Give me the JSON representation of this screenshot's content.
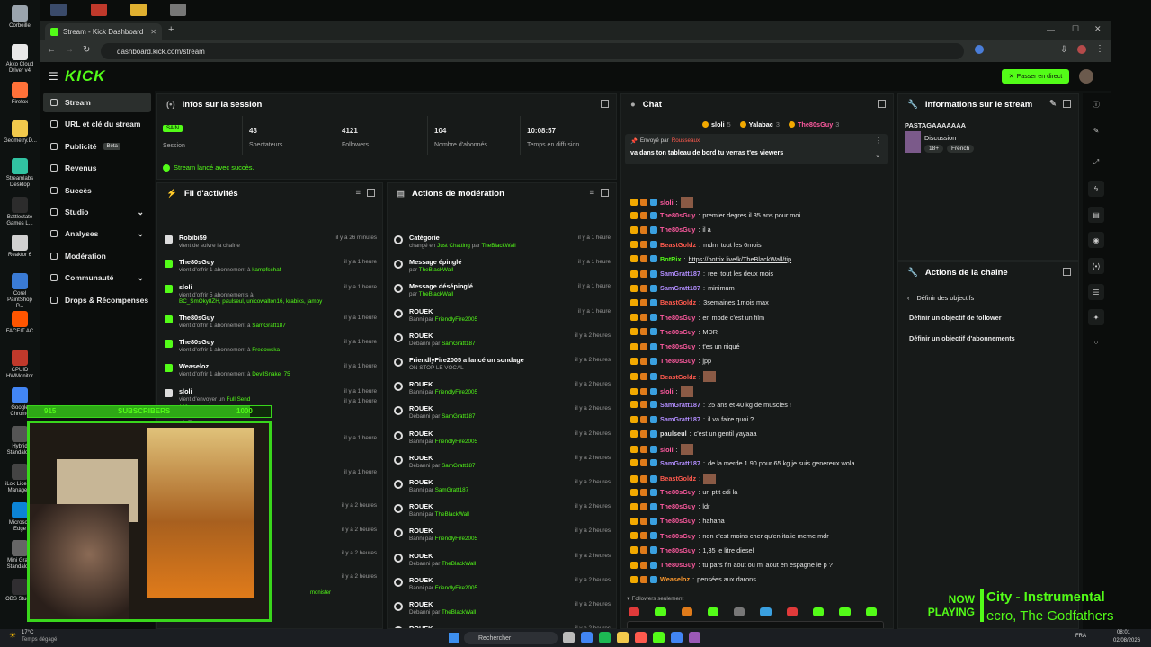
{
  "desktop": {
    "icons": [
      {
        "label": "Corbeille",
        "color": "#9aa4ad"
      },
      {
        "label": "Akko Cloud Driver v4",
        "color": "#e8e8e8"
      },
      {
        "label": "Firefox",
        "color": "#ff7139"
      },
      {
        "label": "Geometry.D...",
        "color": "#f2c94c"
      },
      {
        "label": "Streamlabs Desktop",
        "color": "#31c3a2"
      },
      {
        "label": "Battlestate Games L...",
        "color": "#2c2c2c"
      },
      {
        "label": "Reaktor 6",
        "color": "#d0d0d0"
      },
      {
        "label": "Corel PaintShop P...",
        "color": "#3a7bd5"
      },
      {
        "label": "FACEIT AC",
        "color": "#ff5500"
      },
      {
        "label": "CPUID HWMonitor",
        "color": "#c0392b"
      },
      {
        "label": "Google Chrome",
        "color": "#4285f4"
      },
      {
        "label": "Hybrid Standalo...",
        "color": "#555"
      },
      {
        "label": "iLok Licen... Manage...",
        "color": "#444"
      },
      {
        "label": "Microsoft Edge",
        "color": "#0c84d6"
      },
      {
        "label": "Mini Gra... Standalo...",
        "color": "#666"
      },
      {
        "label": "OBS Stud...",
        "color": "#302e31"
      }
    ]
  },
  "browser": {
    "tab_title": "Stream - Kick Dashboard",
    "url": "dashboard.kick.com/stream"
  },
  "kick": {
    "logo": "KICK",
    "go_live": "Passer en direct"
  },
  "sidebar": {
    "items": [
      {
        "label": "Stream",
        "icon": "signal-icon"
      },
      {
        "label": "URL et clé du stream",
        "icon": "link-icon"
      },
      {
        "label": "Publicité",
        "icon": "megaphone-icon",
        "badge": "Beta"
      },
      {
        "label": "Revenus",
        "icon": "dollar-icon"
      },
      {
        "label": "Succès",
        "icon": "trophy-icon"
      },
      {
        "label": "Studio",
        "icon": "tools-icon",
        "chevron": true
      },
      {
        "label": "Analyses",
        "icon": "chart-icon",
        "chevron": true
      },
      {
        "label": "Modération",
        "icon": "shield-icon"
      },
      {
        "label": "Communauté",
        "icon": "users-icon",
        "chevron": true
      },
      {
        "label": "Drops & Récompenses",
        "icon": "gift-icon"
      }
    ]
  },
  "session": {
    "title": "Infos sur la session",
    "status_badge": "SAIN",
    "status_label": "Session",
    "stats": [
      {
        "value": "43",
        "label": "Spectateurs"
      },
      {
        "value": "4121",
        "label": "Followers"
      },
      {
        "value": "104",
        "label": "Nombre d'abonnés"
      },
      {
        "value": "10:08:57",
        "label": "Temps en diffusion"
      }
    ],
    "success": "Stream lancé avec succès."
  },
  "activity": {
    "title": "Fil d'activités",
    "items": [
      {
        "name": "Robibi59",
        "sub": "vient de suivre la chaîne",
        "tag": "",
        "time": "il y a 26 minutes",
        "color": "#dddddd"
      },
      {
        "name": "The80sGuy",
        "sub": "vient d'offrir 1 abonnement à",
        "tag": "kampfschaf",
        "time": "il y a 1 heure",
        "color": "#53fc18"
      },
      {
        "name": "sloli",
        "sub": "vient d'offrir 5 abonnements à:",
        "tag": "BC_SmOky8ZH, paulseul, unicowalton16, krabiks, jamby",
        "time": "il y a 1 heure",
        "color": "#53fc18"
      },
      {
        "name": "The80sGuy",
        "sub": "vient d'offrir 1 abonnement à",
        "tag": "SamGratt187",
        "time": "il y a 1 heure",
        "color": "#53fc18"
      },
      {
        "name": "The80sGuy",
        "sub": "vient d'offrir 1 abonnement à",
        "tag": "Fredowska",
        "time": "il y a 1 heure",
        "color": "#53fc18"
      },
      {
        "name": "Weaseloz",
        "sub": "vient d'offrir 1 abonnement à",
        "tag": "DevilSnake_75",
        "time": "il y a 1 heure",
        "color": "#53fc18"
      },
      {
        "name": "sloli",
        "sub": "vient d'envoyer un",
        "tag": "Full Send",
        "time": "il y a 1 heure",
        "color": "#dddddd",
        "amount": "100"
      }
    ],
    "extra_times": [
      "il y a 1 heure",
      "il y a 1 heure",
      "il y a 1 heure",
      "il y a 2 heures",
      "il y a 2 heures",
      "il y a 2 heures",
      "il y a 2 heures"
    ],
    "partial_name": "sloli",
    "partial_tag": "monister"
  },
  "moderation": {
    "title": "Actions de modération",
    "items": [
      {
        "title": "Catégorie",
        "sub": "changé en",
        "a": "Just Chatting",
        "mid": "par",
        "b": "TheBlackWall",
        "time": "il y a 1 heure"
      },
      {
        "title": "Message épinglé",
        "sub": "par",
        "a": "TheBlackWall",
        "mid": "",
        "b": "",
        "time": "il y a 1 heure"
      },
      {
        "title": "Message désépinglé",
        "sub": "par",
        "a": "TheBlackWall",
        "mid": "",
        "b": "",
        "time": "il y a 1 heure"
      },
      {
        "title": "ROUEK",
        "sub": "Banni par",
        "a": "FriendlyFire2005",
        "mid": "",
        "b": "",
        "time": "il y a 1 heure"
      },
      {
        "title": "ROUEK",
        "sub": "Débanni par",
        "a": "SamGratt187",
        "mid": "",
        "b": "",
        "time": "il y a 2 heures"
      },
      {
        "title": "FriendlyFire2005 a lancé un sondage",
        "sub": "ON STOP LE VOCAL",
        "a": "",
        "mid": "",
        "b": "",
        "time": "il y a 2 heures"
      },
      {
        "title": "ROUEK",
        "sub": "Banni par",
        "a": "FriendlyFire2005",
        "mid": "",
        "b": "",
        "time": "il y a 2 heures"
      },
      {
        "title": "ROUEK",
        "sub": "Débanni par",
        "a": "SamGratt187",
        "mid": "",
        "b": "",
        "time": "il y a 2 heures"
      },
      {
        "title": "ROUEK",
        "sub": "Banni par",
        "a": "FriendlyFire2005",
        "mid": "",
        "b": "",
        "time": "il y a 2 heures"
      },
      {
        "title": "ROUEK",
        "sub": "Débanni par",
        "a": "SamGratt187",
        "mid": "",
        "b": "",
        "time": "il y a 2 heures"
      },
      {
        "title": "ROUEK",
        "sub": "Banni par",
        "a": "SamGratt187",
        "mid": "",
        "b": "",
        "time": "il y a 2 heures"
      },
      {
        "title": "ROUEK",
        "sub": "Banni par",
        "a": "TheBlackWall",
        "mid": "",
        "b": "",
        "time": "il y a 2 heures"
      },
      {
        "title": "ROUEK",
        "sub": "Banni par",
        "a": "FriendlyFire2005",
        "mid": "",
        "b": "",
        "time": "il y a 2 heures"
      },
      {
        "title": "ROUEK",
        "sub": "Débanni par",
        "a": "TheBlackWall",
        "mid": "",
        "b": "",
        "time": "il y a 2 heures"
      },
      {
        "title": "ROUEK",
        "sub": "Banni par",
        "a": "FriendlyFire2005",
        "mid": "",
        "b": "",
        "time": "il y a 2 heures"
      },
      {
        "title": "ROUEK",
        "sub": "Débanni par",
        "a": "TheBlackWall",
        "mid": "",
        "b": "",
        "time": "il y a 2 heures"
      },
      {
        "title": "ROUEK",
        "sub": "Banni par",
        "a": "FriendlyFire2005",
        "mid": "",
        "b": "",
        "time": "il y a 2 heures"
      }
    ]
  },
  "chat": {
    "title": "Chat",
    "top_gifters": [
      {
        "name": "sloli",
        "count": "5"
      },
      {
        "name": "Yalabac",
        "count": "3"
      },
      {
        "name": "The80sGuy",
        "count": "3"
      }
    ],
    "pinned_by": "Envoyé par",
    "pinned_user": "Rousseaux",
    "pinned_text": "va dans ton tableau de bord tu verras t'es viewers",
    "messages": [
      {
        "user": "sloli",
        "color": "#ff5aa0",
        "text": "",
        "emote": true
      },
      {
        "user": "The80sGuy",
        "color": "#ff5aa0",
        "text": "premier degres il 35 ans pour moi"
      },
      {
        "user": "The80sGuy",
        "color": "#ff5aa0",
        "text": "il a"
      },
      {
        "user": "BeastGoldz",
        "color": "#ff5a4e",
        "text": "mdrrr tout les 6mois"
      },
      {
        "user": "BotRix",
        "color": "#53fc18",
        "text": "https://botrix.live/k/TheBlackWall/tip"
      },
      {
        "user": "SamGratt187",
        "color": "#b28dff",
        "text": "reel tout les deux mois"
      },
      {
        "user": "SamGratt187",
        "color": "#b28dff",
        "text": "minimum"
      },
      {
        "user": "BeastGoldz",
        "color": "#ff5a4e",
        "text": "3semaines 1mois max"
      },
      {
        "user": "The80sGuy",
        "color": "#ff5aa0",
        "text": "en mode c'est un film"
      },
      {
        "user": "The80sGuy",
        "color": "#ff5aa0",
        "text": "MDR"
      },
      {
        "user": "The80sGuy",
        "color": "#ff5aa0",
        "text": "t'es un niqué"
      },
      {
        "user": "The80sGuy",
        "color": "#ff5aa0",
        "text": "jpp"
      },
      {
        "user": "BeastGoldz",
        "color": "#ff5a4e",
        "text": "",
        "emote": true
      },
      {
        "user": "sloli",
        "color": "#ff5aa0",
        "text": "",
        "emote": true
      },
      {
        "user": "SamGratt187",
        "color": "#b28dff",
        "text": "25 ans et 40 kg de muscles !"
      },
      {
        "user": "SamGratt187",
        "color": "#b28dff",
        "text": "il va faire quoi ?"
      },
      {
        "user": "paulseul",
        "color": "#e0e0e0",
        "text": "c'est un gentil yayaaa"
      },
      {
        "user": "sloli",
        "color": "#ff5aa0",
        "text": "",
        "emote": true
      },
      {
        "user": "SamGratt187",
        "color": "#b28dff",
        "text": "de la merde 1.90 pour 65 kg je suis genereux wola"
      },
      {
        "user": "BeastGoldz",
        "color": "#ff5a4e",
        "text": "",
        "emote": true
      },
      {
        "user": "The80sGuy",
        "color": "#ff5aa0",
        "text": "un ptit cdi la"
      },
      {
        "user": "The80sGuy",
        "color": "#ff5aa0",
        "text": "ldr"
      },
      {
        "user": "The80sGuy",
        "color": "#ff5aa0",
        "text": "hahaha"
      },
      {
        "user": "The80sGuy",
        "color": "#ff5aa0",
        "text": "non c'est moins cher qu'en italie meme mdr"
      },
      {
        "user": "The80sGuy",
        "color": "#ff5aa0",
        "text": "1,35 le litre diesel"
      },
      {
        "user": "The80sGuy",
        "color": "#ff5aa0",
        "text": "tu pars fin aout ou mi aout en espagne le p ?"
      },
      {
        "user": "Weaseloz",
        "color": "#ff9a2e",
        "text": "pensées aux darons"
      }
    ],
    "followers_only": "Followers seulement"
  },
  "stream_info": {
    "title": "Informations sur le stream",
    "stream_title": "PASTAGAAAAAAA",
    "category": "Discussion",
    "tags": [
      "18+",
      "French"
    ]
  },
  "channel_actions": {
    "title": "Actions de la chaîne",
    "back": "Définir des objectifs",
    "items": [
      "Définir un objectif de follower",
      "Définir un objectif d'abonnements"
    ]
  },
  "overlay": {
    "sub_left": "915",
    "sub_label": "SUBSCRIBERS",
    "sub_right": "1000",
    "now": "NOW",
    "playing": "PLAYING",
    "song": "City - Instrumental",
    "artist": "ecro, The Godfathers"
  },
  "taskbar": {
    "weather_temp": "17°C",
    "weather_text": "Temps dégagé",
    "search": "Rechercher",
    "lang": "FRA",
    "time": "08:01",
    "date": "02/08/2026"
  }
}
